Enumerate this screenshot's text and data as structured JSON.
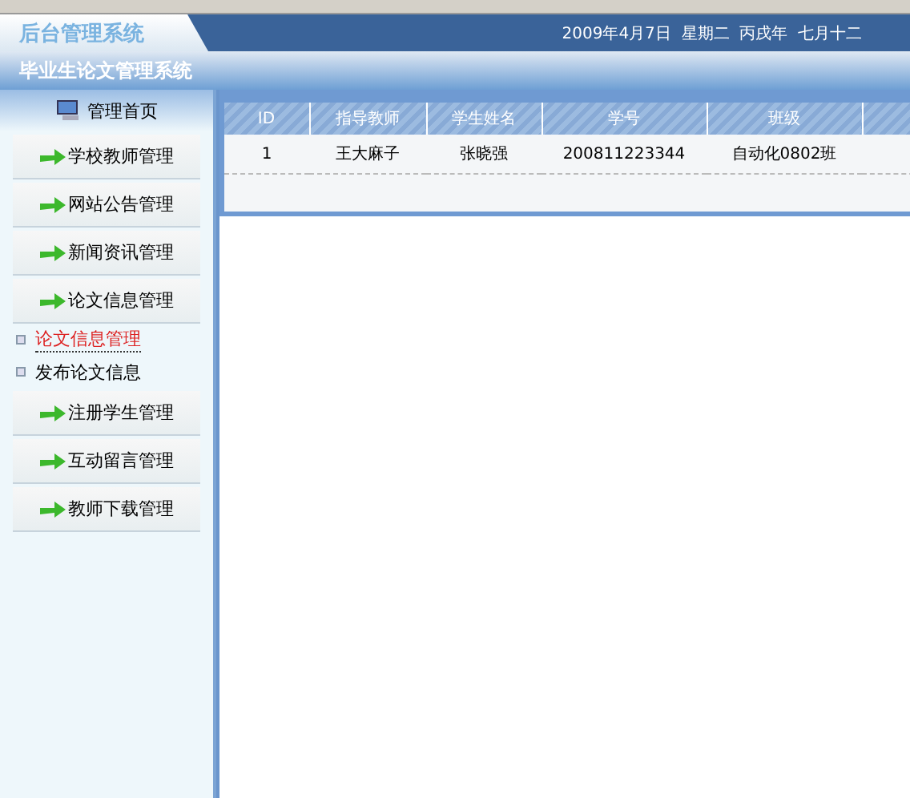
{
  "header": {
    "logo": "后台管理系统",
    "date": "2009年4月7日  星期二  丙戌年  七月十二",
    "subtitle": "毕业生论文管理系统"
  },
  "sidebar": {
    "home": "管理首页",
    "items": [
      {
        "label": "学校教师管理"
      },
      {
        "label": "网站公告管理"
      },
      {
        "label": "新闻资讯管理"
      },
      {
        "label": "论文信息管理",
        "children": [
          {
            "label": "论文信息管理",
            "selected": true
          },
          {
            "label": "发布论文信息",
            "selected": false
          }
        ]
      },
      {
        "label": "注册学生管理"
      },
      {
        "label": "互动留言管理"
      },
      {
        "label": "教师下载管理"
      }
    ]
  },
  "table": {
    "columns": [
      "ID",
      "指导教师",
      "学生姓名",
      "学号",
      "班级"
    ],
    "rows": [
      [
        "1",
        "王大麻子",
        "张晓强",
        "200811223344",
        "自动化0802班"
      ]
    ]
  }
}
